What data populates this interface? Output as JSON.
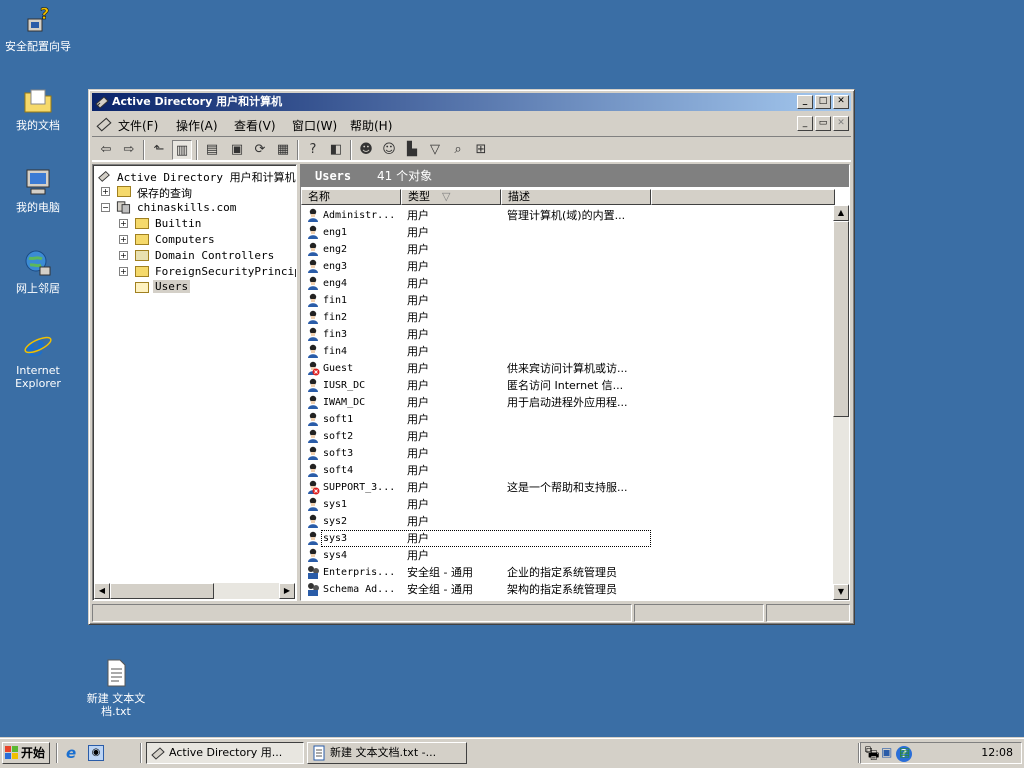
{
  "desktop": {
    "icons": [
      {
        "label": "安全配置向导"
      },
      {
        "label": "我的文档"
      },
      {
        "label": "我的电脑"
      },
      {
        "label": "网上邻居"
      },
      {
        "label": "Internet Explorer"
      },
      {
        "label": "新建 文本文档.txt"
      }
    ]
  },
  "window": {
    "title": "Active Directory 用户和计算机",
    "menu": [
      "文件(F)",
      "操作(A)",
      "查看(V)",
      "窗口(W)",
      "帮助(H)"
    ],
    "tree": {
      "root": "Active Directory 用户和计算机",
      "saved_queries": "保存的查询",
      "domain": "chinaskills.com",
      "children": [
        "Builtin",
        "Computers",
        "Domain Controllers",
        "ForeignSecurityPrincipals",
        "Users"
      ]
    },
    "list": {
      "container": "Users",
      "count": "41 个对象",
      "columns": [
        "名称",
        "类型",
        "描述"
      ],
      "rows": [
        {
          "name": "Administr...",
          "type": "用户",
          "desc": "管理计算机(域)的内置..."
        },
        {
          "name": "eng1",
          "type": "用户",
          "desc": ""
        },
        {
          "name": "eng2",
          "type": "用户",
          "desc": ""
        },
        {
          "name": "eng3",
          "type": "用户",
          "desc": ""
        },
        {
          "name": "eng4",
          "type": "用户",
          "desc": ""
        },
        {
          "name": "fin1",
          "type": "用户",
          "desc": ""
        },
        {
          "name": "fin2",
          "type": "用户",
          "desc": ""
        },
        {
          "name": "fin3",
          "type": "用户",
          "desc": ""
        },
        {
          "name": "fin4",
          "type": "用户",
          "desc": ""
        },
        {
          "name": "Guest",
          "type": "用户",
          "desc": "供来宾访问计算机或访..."
        },
        {
          "name": "IUSR_DC",
          "type": "用户",
          "desc": "匿名访问 Internet 信..."
        },
        {
          "name": "IWAM_DC",
          "type": "用户",
          "desc": "用于启动进程外应用程..."
        },
        {
          "name": "soft1",
          "type": "用户",
          "desc": ""
        },
        {
          "name": "soft2",
          "type": "用户",
          "desc": ""
        },
        {
          "name": "soft3",
          "type": "用户",
          "desc": ""
        },
        {
          "name": "soft4",
          "type": "用户",
          "desc": ""
        },
        {
          "name": "SUPPORT_3...",
          "type": "用户",
          "desc": "这是一个帮助和支持服..."
        },
        {
          "name": "sys1",
          "type": "用户",
          "desc": ""
        },
        {
          "name": "sys2",
          "type": "用户",
          "desc": ""
        },
        {
          "name": "sys3",
          "type": "用户",
          "desc": ""
        },
        {
          "name": "sys4",
          "type": "用户",
          "desc": ""
        },
        {
          "name": "Enterpris...",
          "type": "安全组 - 通用",
          "desc": "企业的指定系统管理员"
        },
        {
          "name": "Schema Ad...",
          "type": "安全组 - 通用",
          "desc": "架构的指定系统管理员"
        }
      ]
    }
  },
  "taskbar": {
    "start": "开始",
    "tasks": [
      "Active Directory 用...",
      "新建 文本文档.txt -..."
    ],
    "clock": "12:08"
  }
}
